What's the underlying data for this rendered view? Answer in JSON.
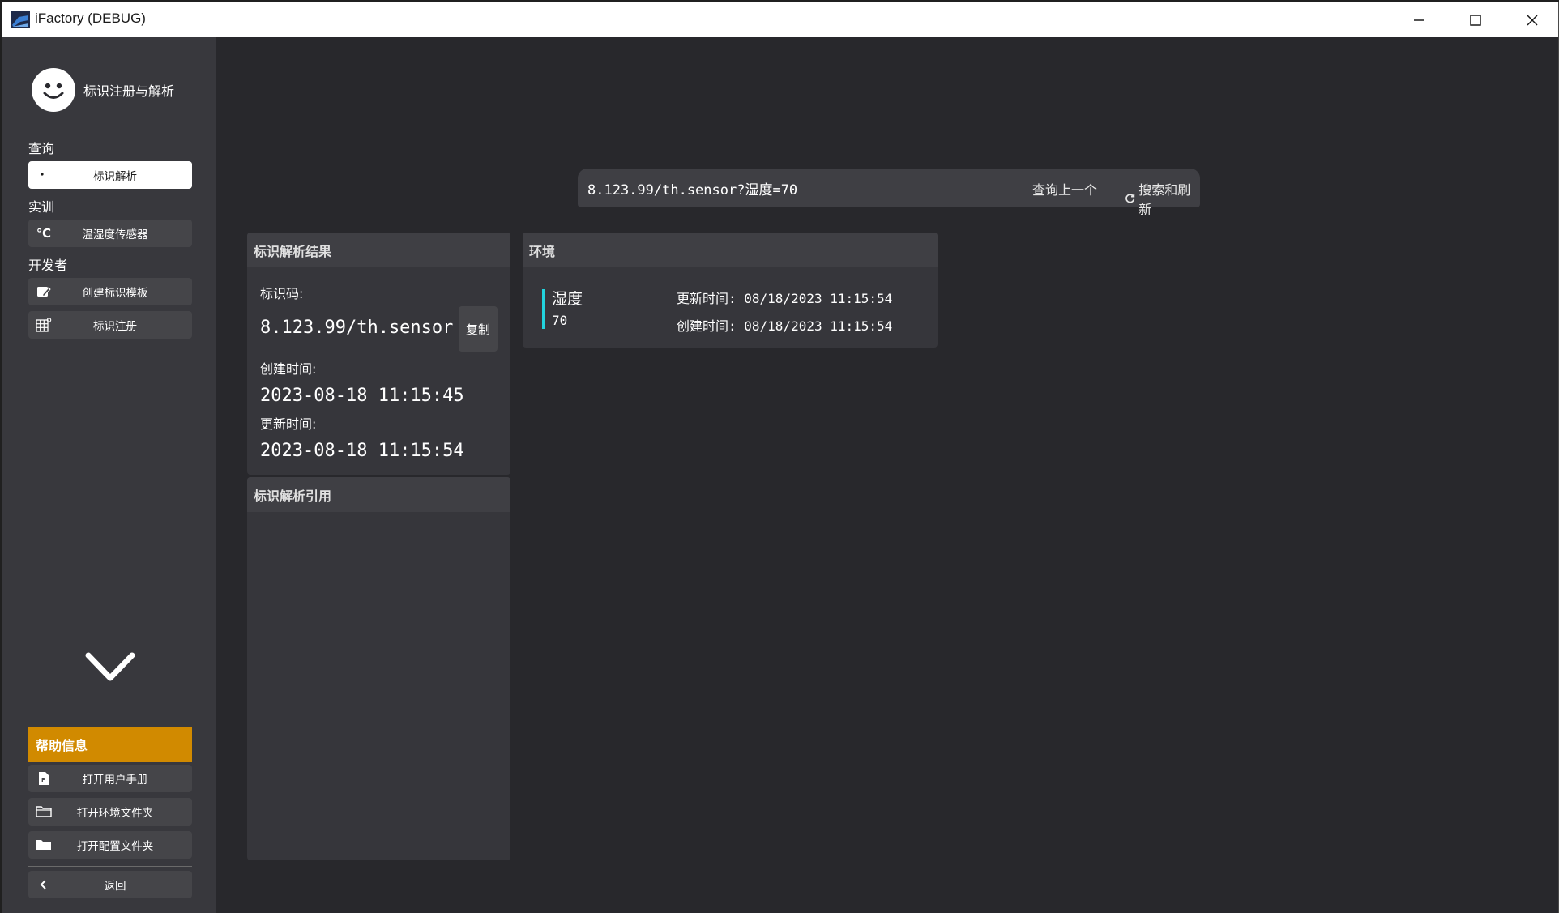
{
  "window": {
    "title": "iFactory (DEBUG)"
  },
  "sidebar": {
    "profile_name": "标识注册与解析",
    "sections": {
      "query": "查询",
      "training": "实训",
      "developer": "开发者"
    },
    "items": {
      "resolve": {
        "label": "标识解析",
        "icon": "dot-icon"
      },
      "sensor": {
        "label": "温湿度传感器",
        "icon": "celsius-icon"
      },
      "template": {
        "label": "创建标识模板",
        "icon": "edit-icon"
      },
      "register": {
        "label": "标识注册",
        "icon": "grid-icon"
      }
    },
    "help": {
      "header": "帮助信息",
      "manual": "打开用户手册",
      "env_folder": "打开环境文件夹",
      "config_folder": "打开配置文件夹",
      "back": "返回"
    },
    "celsius_glyph": "℃"
  },
  "search": {
    "value": "8.123.99/th.sensor?湿度=70",
    "prev_label": "查询上一个",
    "refresh_label": "搜索和刷新"
  },
  "result_card": {
    "title": "标识解析结果",
    "code_label": "标识码:",
    "code_value": "8.123.99/th.sensor",
    "copy_label": "复制",
    "created_label": "创建时间:",
    "created_value": "2023-08-18 11:15:45",
    "updated_label": "更新时间:",
    "updated_value": "2023-08-18 11:15:54"
  },
  "reference_card": {
    "title": "标识解析引用"
  },
  "env_card": {
    "title": "环境",
    "name": "湿度",
    "value": "70",
    "updated": "更新时间: 08/18/2023 11:15:54",
    "created": "创建时间: 08/18/2023 11:15:54"
  },
  "colors": {
    "accent_bar": "#22d3dd",
    "help_header": "#d18a00"
  }
}
